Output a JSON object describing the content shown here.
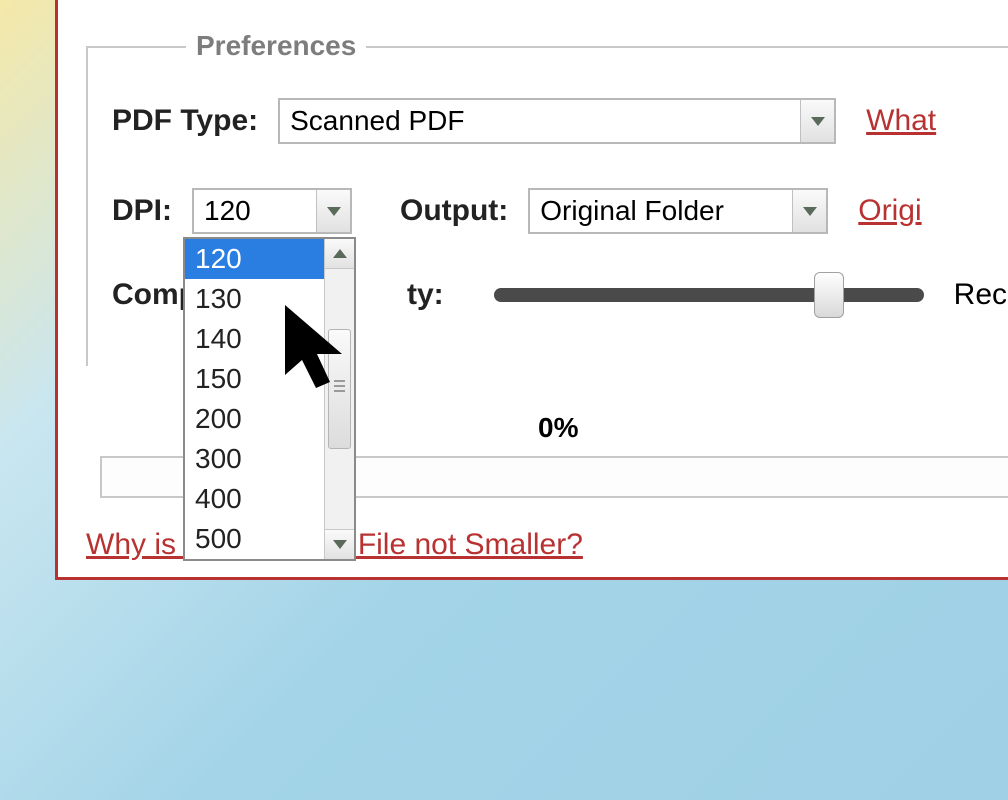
{
  "preferences": {
    "legend": "Preferences",
    "pdf_type": {
      "label": "PDF Type:",
      "value": "Scanned PDF",
      "options": [
        "Scanned PDF"
      ],
      "link": "What"
    },
    "dpi": {
      "label": "DPI:",
      "value": "120",
      "options": [
        "120",
        "130",
        "140",
        "150",
        "200",
        "300",
        "400",
        "500"
      ],
      "selected_index": 0
    },
    "output": {
      "label": "Output:",
      "value": "Original Folder",
      "options": [
        "Original Folder"
      ],
      "link": "Origi"
    },
    "quality": {
      "label_partial": "Comp",
      "label_suffix": "ty:",
      "side_label": "Recon",
      "slider_percent": 74
    }
  },
  "progress": {
    "label": "0%",
    "value": 0
  },
  "bottom_link_prefix": "Why is",
  "bottom_link_suffix": "ressed File not Smaller?"
}
